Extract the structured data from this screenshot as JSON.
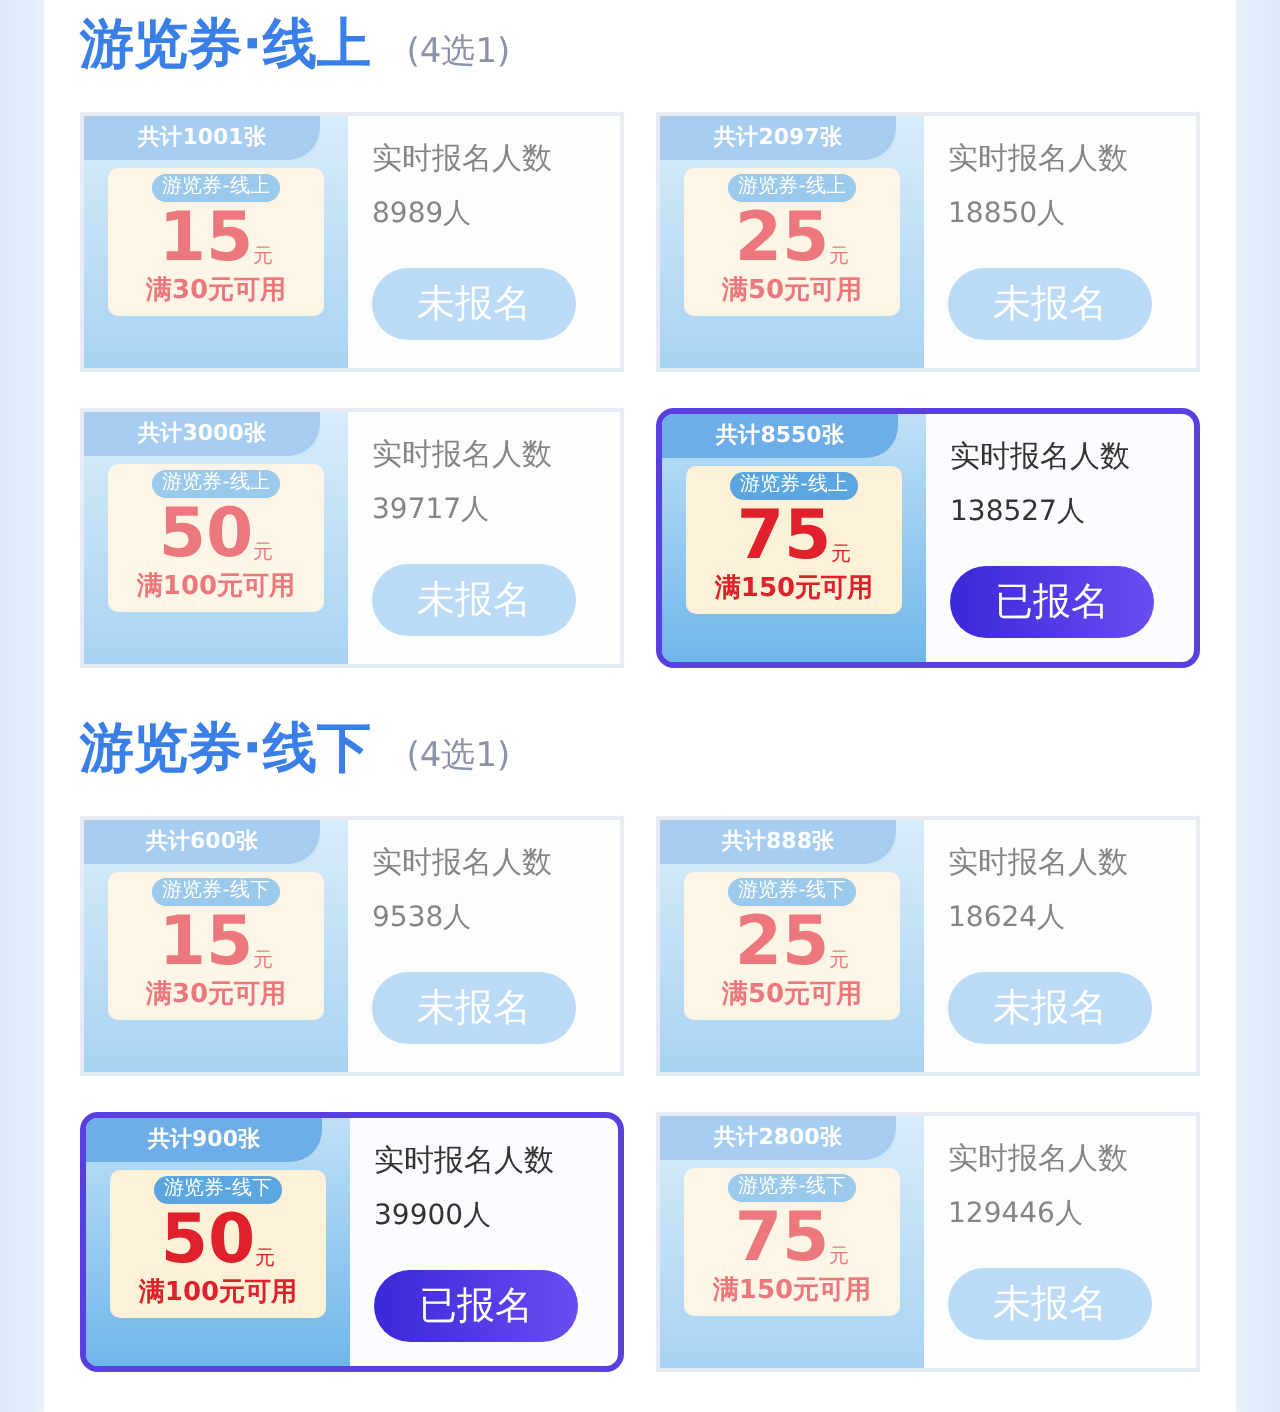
{
  "sections": [
    {
      "title": "游览券·线上",
      "note": "(4选1)",
      "cards": [
        {
          "total": "共计1001张",
          "tag": "游览券-线上",
          "amount": "15",
          "unit": "元",
          "condition": "满30元可用",
          "label": "实时报名人数",
          "count": "8989人",
          "button": "未报名",
          "selected": false
        },
        {
          "total": "共计2097张",
          "tag": "游览券-线上",
          "amount": "25",
          "unit": "元",
          "condition": "满50元可用",
          "label": "实时报名人数",
          "count": "18850人",
          "button": "未报名",
          "selected": false
        },
        {
          "total": "共计3000张",
          "tag": "游览券-线上",
          "amount": "50",
          "unit": "元",
          "condition": "满100元可用",
          "label": "实时报名人数",
          "count": "39717人",
          "button": "未报名",
          "selected": false
        },
        {
          "total": "共计8550张",
          "tag": "游览券-线上",
          "amount": "75",
          "unit": "元",
          "condition": "满150元可用",
          "label": "实时报名人数",
          "count": "138527人",
          "button": "已报名",
          "selected": true
        }
      ]
    },
    {
      "title": "游览券·线下",
      "note": "(4选1)",
      "cards": [
        {
          "total": "共计600张",
          "tag": "游览券-线下",
          "amount": "15",
          "unit": "元",
          "condition": "满30元可用",
          "label": "实时报名人数",
          "count": "9538人",
          "button": "未报名",
          "selected": false
        },
        {
          "total": "共计888张",
          "tag": "游览券-线下",
          "amount": "25",
          "unit": "元",
          "condition": "满50元可用",
          "label": "实时报名人数",
          "count": "18624人",
          "button": "未报名",
          "selected": false
        },
        {
          "total": "共计900张",
          "tag": "游览券-线下",
          "amount": "50",
          "unit": "元",
          "condition": "满100元可用",
          "label": "实时报名人数",
          "count": "39900人",
          "button": "已报名",
          "selected": true
        },
        {
          "total": "共计2800张",
          "tag": "游览券-线下",
          "amount": "75",
          "unit": "元",
          "condition": "满150元可用",
          "label": "实时报名人数",
          "count": "129446人",
          "button": "未报名",
          "selected": false
        }
      ]
    }
  ]
}
